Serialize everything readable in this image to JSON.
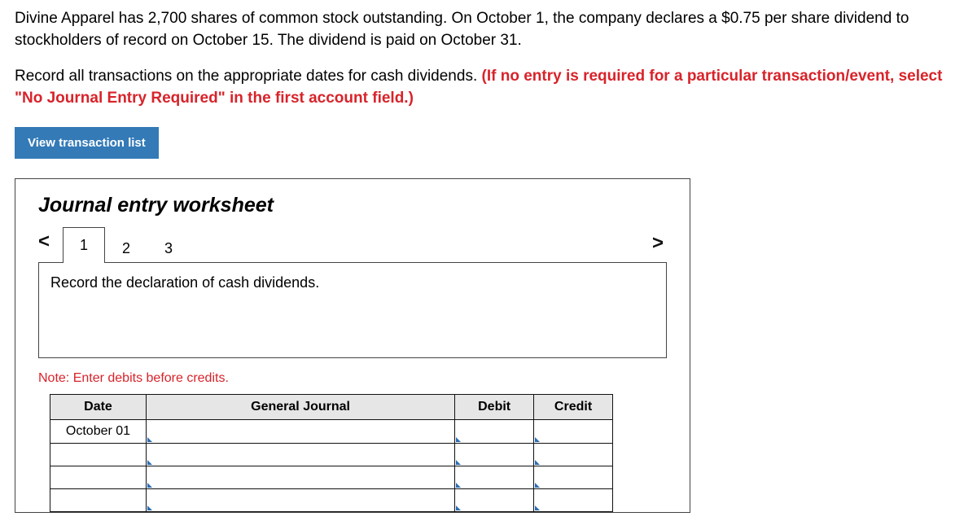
{
  "question": {
    "p1": "Divine Apparel has 2,700 shares of common stock outstanding. On October 1, the company declares a $0.75 per share dividend to stockholders of record on October 15. The dividend is paid on October 31.",
    "p2_a": "Record all transactions on the appropriate dates for cash dividends. ",
    "p2_b": "(If no entry is required for a particular transaction/event, select \"No Journal Entry Required\" in the first account field.)"
  },
  "view_btn_label": "View transaction list",
  "worksheet": {
    "title": "Journal entry worksheet",
    "prev": "<",
    "next": ">",
    "tabs": [
      "1",
      "2",
      "3"
    ],
    "active_tab": 0,
    "description": "Record the declaration of cash dividends.",
    "note": "Note: Enter debits before credits.",
    "columns": {
      "date": "Date",
      "gj": "General Journal",
      "debit": "Debit",
      "credit": "Credit"
    },
    "rows": [
      {
        "date": "October 01",
        "gj": "",
        "debit": "",
        "credit": ""
      },
      {
        "date": "",
        "gj": "",
        "debit": "",
        "credit": ""
      },
      {
        "date": "",
        "gj": "",
        "debit": "",
        "credit": ""
      },
      {
        "date": "",
        "gj": "",
        "debit": "",
        "credit": ""
      }
    ]
  }
}
